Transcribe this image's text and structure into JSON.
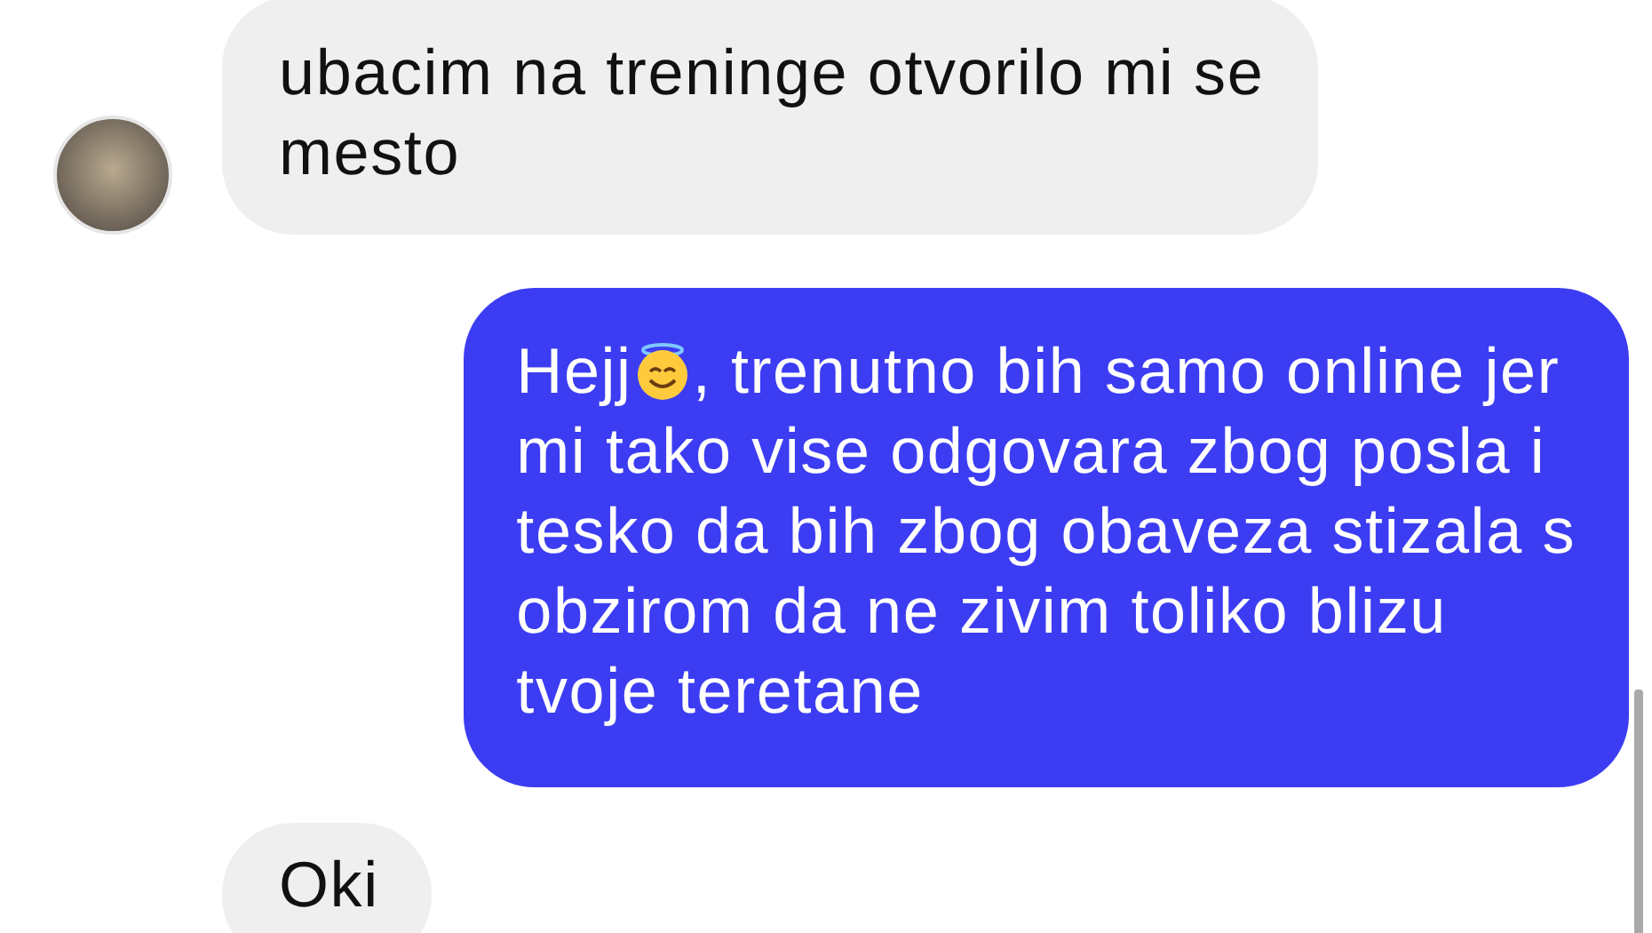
{
  "messages": [
    {
      "kind": "received",
      "avatar": true,
      "lines": [
        [
          {
            "kind": "text",
            "text": "ubacim na treninge otvorilo mi se"
          }
        ],
        [
          {
            "kind": "text",
            "text": "mesto"
          }
        ]
      ]
    },
    {
      "kind": "sent",
      "lines": [
        [
          {
            "kind": "text",
            "text": "Hejj"
          },
          {
            "kind": "emoji"
          },
          {
            "kind": "text",
            "text": ", trenutno bih samo online jer"
          }
        ],
        [
          {
            "kind": "text",
            "text": "mi tako vise odgovara zbog posla i"
          }
        ],
        [
          {
            "kind": "text",
            "text": "tesko da bih zbog obaveza stizala s"
          }
        ],
        [
          {
            "kind": "text",
            "text": "obzirom da ne zivim toliko blizu"
          }
        ],
        [
          {
            "kind": "text",
            "text": "tvoje teretane"
          }
        ]
      ]
    },
    {
      "kind": "received",
      "avatar": false,
      "lines": [
        [
          {
            "kind": "text",
            "text": "Oki"
          }
        ]
      ]
    }
  ]
}
